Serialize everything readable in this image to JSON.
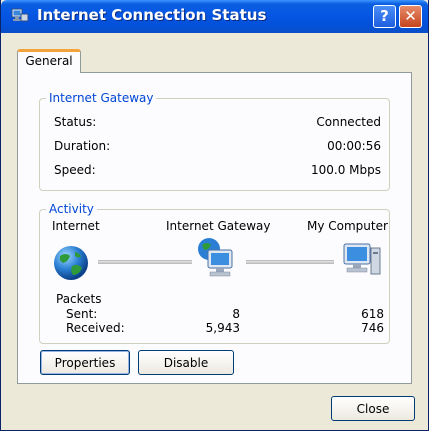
{
  "window": {
    "title": "Internet Connection Status",
    "help_label": "?",
    "close_label": "✕"
  },
  "tabs": [
    {
      "label": "General",
      "active": true
    }
  ],
  "gateway_group": {
    "legend": "Internet Gateway",
    "rows": [
      {
        "label": "Status:",
        "value": "Connected"
      },
      {
        "label": "Duration:",
        "value": "00:00:56"
      },
      {
        "label": "Speed:",
        "value": "100.0 Mbps"
      }
    ]
  },
  "activity_group": {
    "legend": "Activity",
    "nodes": [
      {
        "label": "Internet",
        "icon": "globe-icon"
      },
      {
        "label": "Internet Gateway",
        "icon": "gateway-computer-icon"
      },
      {
        "label": "My Computer",
        "icon": "computer-icon"
      }
    ],
    "packets_label": "Packets",
    "sent_label": "Sent:",
    "received_label": "Received:",
    "gateway_sent": "8",
    "gateway_received": "5,943",
    "computer_sent": "618",
    "computer_received": "746"
  },
  "buttons": {
    "properties": "Properties",
    "disable": "Disable",
    "close": "Close"
  },
  "colors": {
    "titlebar": "#0656e4",
    "legend_text": "#0046d5",
    "tab_highlight": "#f3a33a",
    "window_bg": "#ece9d8"
  }
}
